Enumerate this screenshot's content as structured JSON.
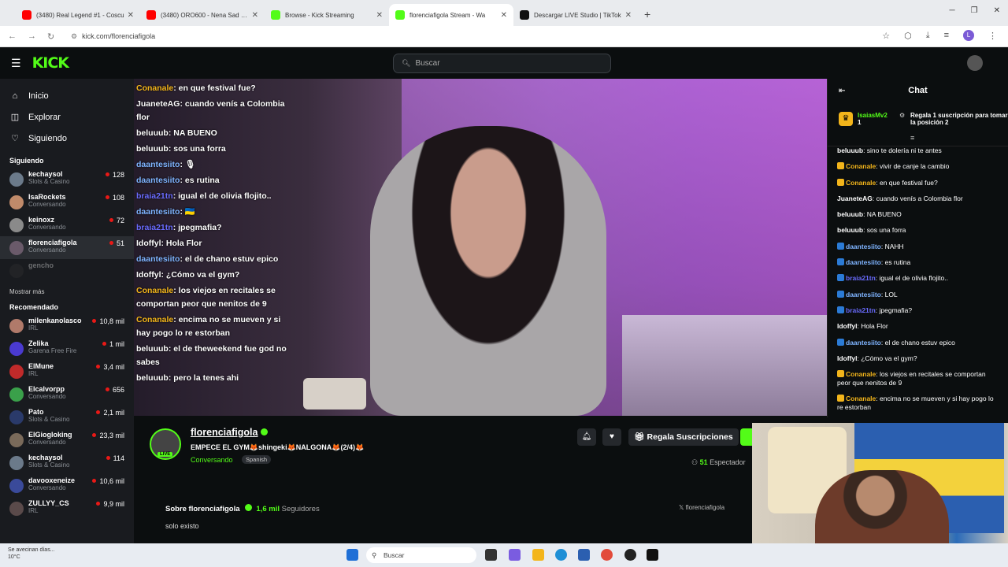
{
  "browser": {
    "tabs": [
      {
        "title": "(3480) Real Legend #1 - Coscu",
        "icon": "youtube-icon",
        "color": "#ff0000"
      },
      {
        "title": "(3480) ORO600 - Nena Sad Re",
        "icon": "youtube-icon",
        "color": "#ff0000"
      },
      {
        "title": "Browse - Kick Streaming",
        "icon": "kick-icon",
        "color": "#53fc18"
      },
      {
        "title": "florenciafigola Stream - Wa",
        "icon": "kick-icon",
        "color": "#53fc18",
        "active": true
      },
      {
        "title": "Descargar LIVE Studio | TikTok",
        "icon": "tiktok-icon",
        "color": "#111111"
      }
    ],
    "url": "kick.com/florenciafigola"
  },
  "header": {
    "logo": "KICK",
    "search_placeholder": "Buscar"
  },
  "sidebar": {
    "nav": [
      {
        "label": "Inicio",
        "icon": "home-icon"
      },
      {
        "label": "Explorar",
        "icon": "compass-icon"
      },
      {
        "label": "Siguiendo",
        "icon": "heart-icon"
      }
    ],
    "following_title": "Siguiendo",
    "following": [
      {
        "name": "kechaysol",
        "category": "Slots & Casino",
        "viewers": "128",
        "color": "#6b7a8a"
      },
      {
        "name": "IsaRockets",
        "category": "Conversando",
        "viewers": "108",
        "color": "#c08a6a"
      },
      {
        "name": "keinoxz",
        "category": "Conversando",
        "viewers": "72",
        "color": "#8a8a8a"
      },
      {
        "name": "florenciafigola",
        "category": "Conversando",
        "viewers": "51",
        "color": "#6a5a6a",
        "active": true
      },
      {
        "name": "gencho",
        "category": "",
        "viewers": "",
        "color": "#333333",
        "offline": true
      }
    ],
    "more_label": "Mostrar más",
    "recommended_title": "Recomendado",
    "recommended": [
      {
        "name": "milenkanolasco",
        "category": "IRL",
        "viewers": "10,8 mil",
        "color": "#b07a6a"
      },
      {
        "name": "Zelika",
        "category": "Garena Free Fire",
        "viewers": "1 mil",
        "color": "#4a3ad0"
      },
      {
        "name": "ElMune",
        "category": "IRL",
        "viewers": "3,4 mil",
        "color": "#c02a2a"
      },
      {
        "name": "Elcalvorpp",
        "category": "Conversando",
        "viewers": "656",
        "color": "#3aa04a"
      },
      {
        "name": "Pato",
        "category": "Slots & Casino",
        "viewers": "2,1 mil",
        "color": "#2a3a6a"
      },
      {
        "name": "ElGiogloking",
        "category": "Conversando",
        "viewers": "23,3 mil",
        "color": "#7a6a5a"
      },
      {
        "name": "kechaysol",
        "category": "Slots & Casino",
        "viewers": "114",
        "color": "#6b7a8a"
      },
      {
        "name": "davooxeneize",
        "category": "Conversando",
        "viewers": "10,6 mil",
        "color": "#3a4a9a"
      },
      {
        "name": "ZULLYY_CS",
        "category": "IRL",
        "viewers": "9,9 mil",
        "color": "#5a4a4a"
      }
    ]
  },
  "overlay_chat": [
    {
      "user": "Conanale",
      "text": ": en que festival fue?",
      "color": "#f3b51b"
    },
    {
      "user": "JuaneteAG",
      "text": ": cuando venís a Colombia flor",
      "color": "#ffffff"
    },
    {
      "user": "beluuub",
      "text": ": NA BUENO",
      "color": "#ffffff"
    },
    {
      "user": "beluuub",
      "text": ": sos una forra",
      "color": "#ffffff"
    },
    {
      "user": "daantesiito",
      "text": ": 🎙",
      "color": "#7fb4ff"
    },
    {
      "user": "daantesiito",
      "text": ": es rutina",
      "color": "#7fb4ff"
    },
    {
      "user": "braia21tn",
      "text": ": igual el de olivia flojito..",
      "color": "#6a6cff"
    },
    {
      "user": "daantesiito",
      "text": ": 🇺🇦",
      "color": "#7fb4ff"
    },
    {
      "user": "braia21tn",
      "text": ": jpegmafia?",
      "color": "#6a6cff"
    },
    {
      "user": "Idoffyl",
      "text": ": Hola Flor",
      "color": "#ffffff"
    },
    {
      "user": "daantesiito",
      "text": ": el de chano estuv epico",
      "color": "#7fb4ff"
    },
    {
      "user": "Idoffyl",
      "text": ": ¿Cómo va el gym?",
      "color": "#ffffff"
    },
    {
      "user": "Conanale",
      "text": ": los viejos en recitales se comportan peor que nenitos de 9",
      "color": "#f3b51b"
    },
    {
      "user": "Conanale",
      "text": ": encima no se mueven y si hay pogo lo re estorban",
      "color": "#f3b51b"
    },
    {
      "user": "beluuub",
      "text": ": el de theweekend fue god no sabes",
      "color": "#ffffff"
    },
    {
      "user": "beluuub",
      "text": ": pero la tenes ahi",
      "color": "#ffffff"
    }
  ],
  "chat": {
    "title": "Chat",
    "pinned_user": "IsaiasMv2",
    "pinned_count": "1",
    "pinned_text": "Regala 1 suscripción para tomar la posición 2",
    "messages": [
      {
        "user": "beluuub",
        "text": ": sino te dolería ni te antes",
        "color": "#ffffff"
      },
      {
        "user": "Conanale",
        "text": ": vivir de canje la cambio",
        "color": "#f3b51b"
      },
      {
        "user": "Conanale",
        "text": ": en que festival fue?",
        "color": "#f3b51b"
      },
      {
        "user": "JuaneteAG",
        "text": ": cuando venís a Colombia flor",
        "color": "#ffffff"
      },
      {
        "user": "beluuub",
        "text": ": NA BUENO",
        "color": "#ffffff"
      },
      {
        "user": "beluuub",
        "text": ": sos una forra",
        "color": "#ffffff"
      },
      {
        "user": "daantesiito",
        "text": ": NAHH",
        "color": "#7fb4ff"
      },
      {
        "user": "daantesiito",
        "text": ": es rutina",
        "color": "#7fb4ff"
      },
      {
        "user": "braia21tn",
        "text": ": igual el de olivia flojito..",
        "color": "#6a6cff"
      },
      {
        "user": "daantesiito",
        "text": ": LOL",
        "color": "#7fb4ff"
      },
      {
        "user": "braia21tn",
        "text": ": jpegmafia?",
        "color": "#6a6cff"
      },
      {
        "user": "Idoffyl",
        "text": ": Hola Flor",
        "color": "#ffffff"
      },
      {
        "user": "daantesiito",
        "text": ": el de chano estuv epico",
        "color": "#7fb4ff"
      },
      {
        "user": "Idoffyl",
        "text": ": ¿Cómo va el gym?",
        "color": "#ffffff"
      },
      {
        "user": "Conanale",
        "text": ": los viejos en recitales se comportan peor que nenitos de 9",
        "color": "#f3b51b"
      },
      {
        "user": "Conanale",
        "text": ": encima no se mueven y si hay pogo lo re estorban",
        "color": "#f3b51b"
      }
    ]
  },
  "stream": {
    "channel": "florenciafigola",
    "title": "EMPECE EL GYM🦊shingeki🦊NALGONA🦊(2/4)🦊",
    "category": "Conversando",
    "language": "Spanish",
    "live_badge": "LIVE",
    "gift_label": "Regala Suscripciones",
    "viewers": "51",
    "viewers_label": "Espectador",
    "about_label": "Sobre florenciafigola",
    "followers": "1,6 mil",
    "followers_label": "Seguidores",
    "description": "solo existo",
    "x_handle": "florenciafigola"
  },
  "taskbar": {
    "weather_line1": "Se avecinan días...",
    "weather_line2": "10°C",
    "search_placeholder": "Buscar"
  }
}
